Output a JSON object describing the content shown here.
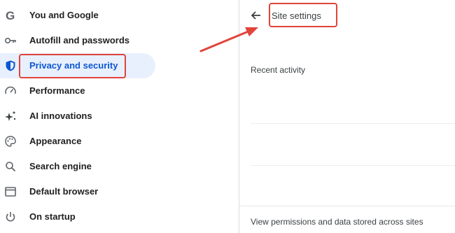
{
  "sidebar": {
    "items": [
      {
        "label": "You and Google",
        "icon": "google-g-icon"
      },
      {
        "label": "Autofill and passwords",
        "icon": "key-icon"
      },
      {
        "label": "Privacy and security",
        "icon": "shield-icon",
        "active": true
      },
      {
        "label": "Performance",
        "icon": "speedometer-icon"
      },
      {
        "label": "AI innovations",
        "icon": "sparkle-icon"
      },
      {
        "label": "Appearance",
        "icon": "palette-icon"
      },
      {
        "label": "Search engine",
        "icon": "search-icon"
      },
      {
        "label": "Default browser",
        "icon": "browser-window-icon"
      },
      {
        "label": "On startup",
        "icon": "power-icon"
      }
    ]
  },
  "main": {
    "back_icon": "arrow-back-icon",
    "title": "Site settings",
    "recent_activity_heading": "Recent activity",
    "footer_description": "View permissions and data stored across sites"
  },
  "annotation": {
    "color": "#e0443a"
  },
  "colors": {
    "active_bg": "#e8f0fe",
    "active_text": "#0b57d0"
  }
}
